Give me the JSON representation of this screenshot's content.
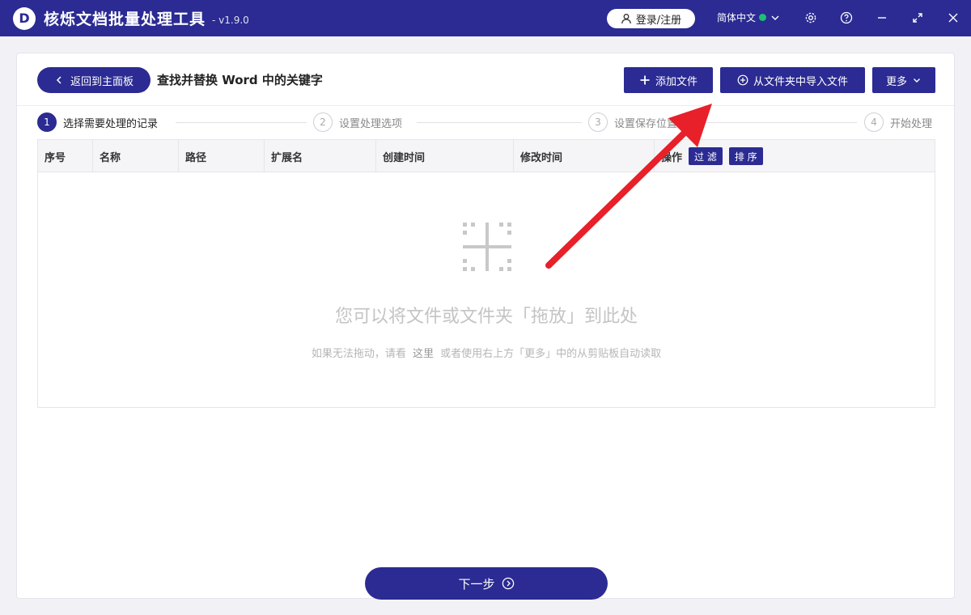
{
  "app": {
    "logo_letter": "D",
    "title": "核烁文档批量处理工具",
    "version": "- v1.9.0",
    "login_label": "登录/注册",
    "language": "简体中文"
  },
  "header": {
    "back_label": "返回到主面板",
    "page_title": "查找并替换 Word 中的关键字",
    "add_file_label": "添加文件",
    "import_folder_label": "从文件夹中导入文件",
    "more_label": "更多"
  },
  "steps": [
    {
      "num": "1",
      "label": "选择需要处理的记录"
    },
    {
      "num": "2",
      "label": "设置处理选项"
    },
    {
      "num": "3",
      "label": "设置保存位置"
    },
    {
      "num": "4",
      "label": "开始处理"
    }
  ],
  "table": {
    "columns": [
      "序号",
      "名称",
      "路径",
      "扩展名",
      "创建时间",
      "修改时间",
      "操作"
    ],
    "filter_label": "过 滤",
    "sort_label": "排 序"
  },
  "empty": {
    "main": "您可以将文件或文件夹「拖放」到此处",
    "sub_prefix": "如果无法拖动，请看",
    "sub_link": "这里",
    "sub_suffix": "或者使用右上方「更多」中的从剪贴板自动读取"
  },
  "footer": {
    "next_label": "下一步"
  },
  "colors": {
    "primary": "#2b2b93",
    "status_dot": "#1fbf73",
    "annotation_arrow": "#e8202a"
  }
}
